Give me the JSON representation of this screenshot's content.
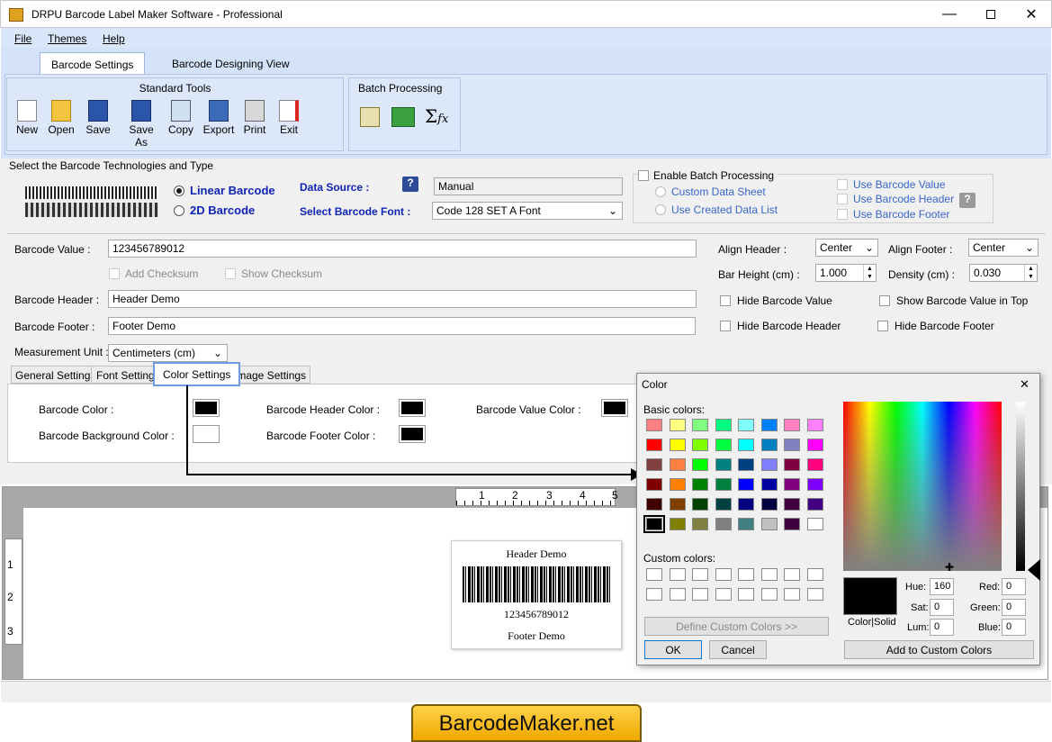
{
  "window": {
    "title": "DRPU Barcode Label Maker Software - Professional"
  },
  "menu": [
    "File",
    "Themes",
    "Help"
  ],
  "tabs": {
    "settings": "Barcode Settings",
    "designing": "Barcode Designing View"
  },
  "standard_tools": {
    "title": "Standard Tools",
    "items": [
      "New",
      "Open",
      "Save",
      "Save As",
      "Copy",
      "Export",
      "Print",
      "Exit"
    ]
  },
  "batch_group": {
    "title": "Batch Processing"
  },
  "tech": {
    "section_label": "Select the Barcode Technologies and Type",
    "linear": "Linear Barcode",
    "twod": "2D Barcode",
    "data_source_label": "Data Source :",
    "data_source_value": "Manual",
    "font_label": "Select Barcode Font :",
    "font_value": "Code 128 SET A Font"
  },
  "batch": {
    "enable": "Enable Batch Processing",
    "custom": "Custom Data Sheet",
    "created": "Use Created Data List",
    "use_value": "Use Barcode Value",
    "use_header": "Use Barcode Header",
    "use_footer": "Use Barcode Footer"
  },
  "form": {
    "value_label": "Barcode Value :",
    "value": "123456789012",
    "add_checksum": "Add Checksum",
    "show_checksum": "Show Checksum",
    "header_label": "Barcode Header :",
    "header": "Header Demo",
    "footer_label": "Barcode Footer :",
    "footer": "Footer Demo",
    "unit_label": "Measurement Unit :",
    "unit": "Centimeters (cm)",
    "align_header_label": "Align Header :",
    "align_header": "Center",
    "align_footer_label": "Align Footer :",
    "align_footer": "Center",
    "bar_height_label": "Bar Height (cm) :",
    "bar_height": "1.000",
    "density_label": "Density (cm) :",
    "density": "0.030",
    "hide_value": "Hide Barcode Value",
    "show_top": "Show Barcode Value in Top",
    "hide_header": "Hide Barcode Header",
    "hide_footer": "Hide Barcode Footer"
  },
  "subtabs": [
    "General Settings",
    "Font Settings",
    "Color Settings",
    "Image Settings"
  ],
  "colors": {
    "barcode_color": "Barcode Color :",
    "background_color": "Barcode Background Color :",
    "header_color": "Barcode Header Color :",
    "footer_color": "Barcode Footer Color :",
    "value_color": "Barcode Value Color :"
  },
  "preview": {
    "header": "Header Demo",
    "value": "123456789012",
    "footer": "Footer Demo"
  },
  "ruler_h": [
    "1",
    "2",
    "3",
    "4",
    "5"
  ],
  "ruler_v": [
    "1",
    "2",
    "3"
  ],
  "color_dialog": {
    "title": "Color",
    "basic_label": "Basic colors:",
    "custom_label": "Custom colors:",
    "define": "Define Custom Colors >>",
    "ok": "OK",
    "cancel": "Cancel",
    "color_solid": "Color|Solid",
    "add": "Add to Custom Colors",
    "hue_label": "Hue:",
    "hue": "160",
    "sat_label": "Sat:",
    "sat": "0",
    "lum_label": "Lum:",
    "lum": "0",
    "red_label": "Red:",
    "red": "0",
    "green_label": "Green:",
    "green": "0",
    "blue_label": "Blue:",
    "blue": "0",
    "basic_colors": [
      "#ff8080",
      "#ffff80",
      "#80ff80",
      "#00ff80",
      "#80ffff",
      "#0080ff",
      "#ff80c0",
      "#ff80ff",
      "#ff0000",
      "#ffff00",
      "#80ff00",
      "#00ff40",
      "#00ffff",
      "#0080c0",
      "#8080c0",
      "#ff00ff",
      "#804040",
      "#ff8040",
      "#00ff00",
      "#008080",
      "#004080",
      "#8080ff",
      "#800040",
      "#ff0080",
      "#800000",
      "#ff8000",
      "#008000",
      "#008040",
      "#0000ff",
      "#0000a0",
      "#800080",
      "#8000ff",
      "#400000",
      "#804000",
      "#004000",
      "#004040",
      "#000080",
      "#000040",
      "#400040",
      "#400080",
      "#000000",
      "#808000",
      "#808040",
      "#808080",
      "#408080",
      "#c0c0c0",
      "#400040",
      "#ffffff"
    ]
  },
  "brand": "BarcodeMaker.net"
}
